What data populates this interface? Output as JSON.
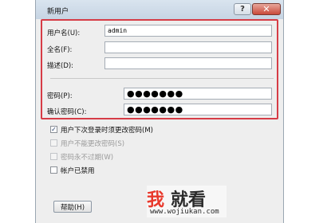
{
  "window": {
    "title": "新用户",
    "help_glyph": "?",
    "close_glyph": "✕"
  },
  "fields": {
    "username": {
      "label": "用户名(U):",
      "value": "admin"
    },
    "fullname": {
      "label": "全名(F):",
      "value": ""
    },
    "description": {
      "label": "描述(D):",
      "value": ""
    },
    "password": {
      "label": "密码(P):",
      "value": "●●●●●●●"
    },
    "confirm_password": {
      "label": "确认密码(C):",
      "value": "●●●●●●●"
    }
  },
  "options": {
    "must_change": {
      "label": "用户下次登录时须更改密码(M)",
      "checked": true,
      "check_glyph": "✓"
    },
    "cannot_change": {
      "label": "用户不能更改密码(S)"
    },
    "never_expires": {
      "label": "密码永不过期(W)"
    },
    "disabled_account": {
      "label": "帐户已禁用"
    }
  },
  "buttons": {
    "help": "帮助(H)"
  },
  "watermark": {
    "text_a": "我",
    "text_b": "就看",
    "url": "www.wojiukan.com"
  },
  "colors": {
    "highlight_border": "#d63c46",
    "close_button": "#c9493a",
    "watermark_accent": "#e8392c"
  }
}
